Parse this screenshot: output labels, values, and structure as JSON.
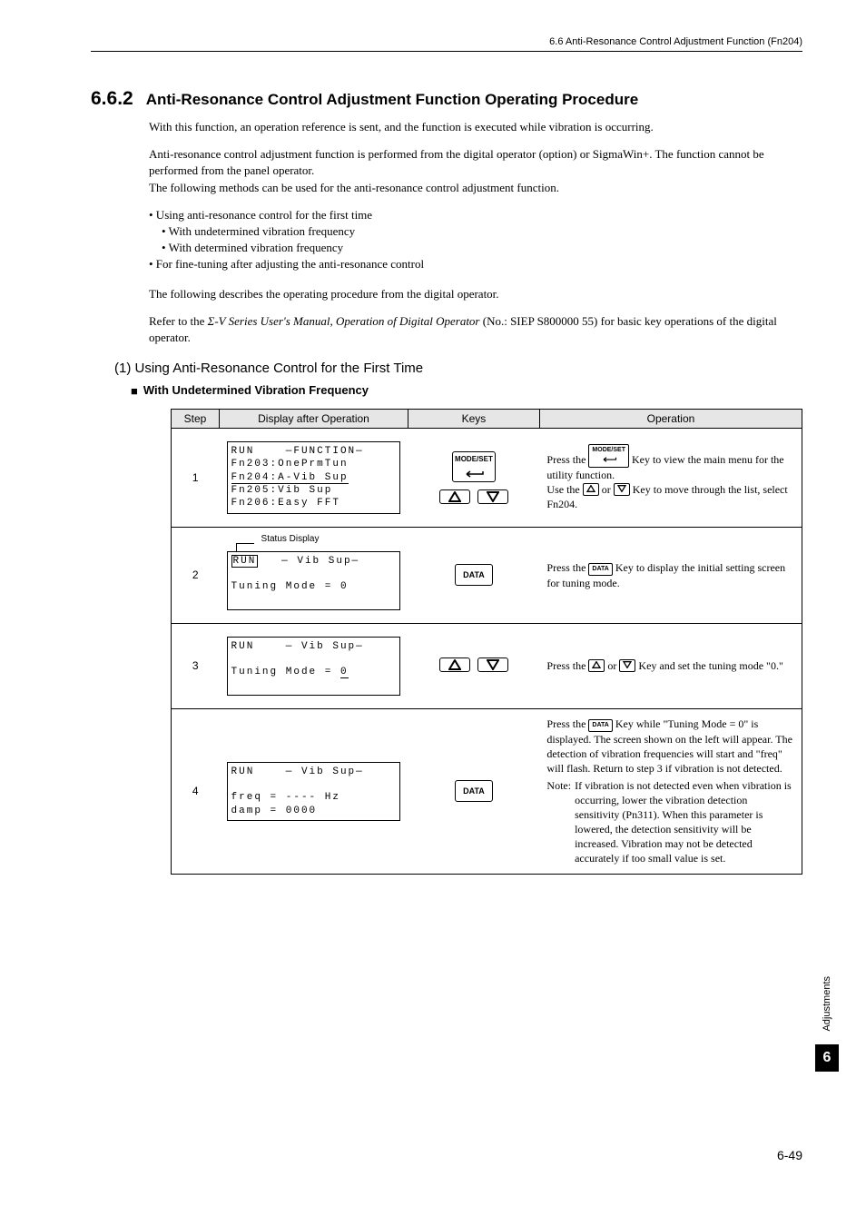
{
  "header": {
    "running": "6.6  Anti-Resonance Control Adjustment Function (Fn204)"
  },
  "section": {
    "number": "6.6.2",
    "title": "Anti-Resonance Control Adjustment Function Operating Procedure"
  },
  "paras": {
    "p1": "With this function, an operation reference is sent, and the function is executed while vibration is occurring.",
    "p2a": "Anti-resonance control adjustment function is performed from the digital operator (option) or SigmaWin+. The function cannot be performed from the panel operator.",
    "p2b": "The following methods can be used for the anti-resonance control adjustment function.",
    "b1": "• Using anti-resonance control for the first time",
    "b1a": "• With undetermined vibration frequency",
    "b1b": "• With determined vibration frequency",
    "b2": "• For fine-tuning after adjusting the anti-resonance control",
    "p3": "The following describes the operating procedure from the digital operator.",
    "p4a": "Refer to the ",
    "p4i": "Σ-V Series User's Manual, Operation of Digital Operator",
    "p4b": " (No.: SIEP S800000 55) for basic key operations of the digital operator."
  },
  "sub1": {
    "num": "(1)",
    "title": "Using Anti-Resonance Control for the First Time"
  },
  "sub2": "With Undetermined Vibration Frequency",
  "table": {
    "headers": {
      "step": "Step",
      "disp": "Display after Operation",
      "keys": "Keys",
      "op": "Operation"
    },
    "rows": [
      {
        "step": "1",
        "lcd": "RUN    —FUNCTION—\nFn203:OnePrmTun\nFn204:A-Vib Sup\nFn205:Vib Sup\nFn206:Easy FFT",
        "status_label": "",
        "op_pre": "Press the ",
        "op_mid": " Key to view the main menu for the utility function.",
        "op_line2a": "Use the ",
        "op_line2b": " or ",
        "op_line2c": " Key to move through the list, select Fn204."
      },
      {
        "step": "2",
        "status_label": "Status Display",
        "lcd_line1a": "RUN",
        "lcd_line1b": "   — Vib Sup—",
        "lcd_blank": " ",
        "lcd_line2": "Tuning Mode = 0",
        "op_pre": "Press the ",
        "op_post": " Key to display the initial setting screen for tuning mode."
      },
      {
        "step": "3",
        "lcd_line1": "RUN    — Vib Sup—",
        "lcd_blank": " ",
        "lcd_line2a": "Tuning Mode = ",
        "lcd_line2b": "0",
        "op_pre": "Press the ",
        "op_mid": " or ",
        "op_post": " Key and set the tuning mode \"0.\""
      },
      {
        "step": "4",
        "lcd_line1": "RUN    — Vib Sup—",
        "lcd_blank": " ",
        "lcd_line2": "freq = ---- Hz",
        "lcd_line3": "damp = 0000",
        "op_pre": "Press the ",
        "op_mid": " Key while \"Tuning Mode = 0\" is displayed. The screen shown on the left will appear. The detection of vibration frequencies will start and \"freq\" will flash. Return to step 3 if vibration is not detected.",
        "note_label": "Note:",
        "note_body": "If vibration is not detected even when vibration is occurring, lower the vibration detection sensitivity (Pn311). When this parameter is lowered, the detection sensitivity will be increased. Vibration may not be detected accurately if too small value is set."
      }
    ]
  },
  "keys": {
    "modeset": "MODE/SET",
    "data": "DATA",
    "jog": "DATA"
  },
  "side": {
    "label": "Adjustments",
    "num": "6"
  },
  "pagenum": "6-49"
}
